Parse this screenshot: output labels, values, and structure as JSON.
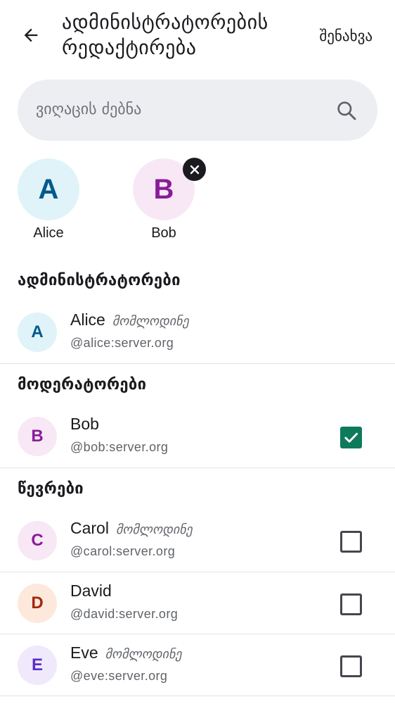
{
  "header": {
    "title": "ადმინისტრატორების რედაქტირება",
    "save_label": "შენახვა",
    "back_icon": "arrow-back-icon"
  },
  "search": {
    "placeholder": "ვიღაცის ძებნა",
    "icon": "search-icon"
  },
  "selected": [
    {
      "initial": "A",
      "name": "Alice",
      "removable": false,
      "avatar_bg": "#dff3f8",
      "avatar_fg": "#005a8c"
    },
    {
      "initial": "B",
      "name": "Bob",
      "removable": true,
      "avatar_bg": "#f8e8f6",
      "avatar_fg": "#8a1c99"
    }
  ],
  "sections": {
    "admins": "ადმინისტრატორები",
    "moderators": "მოდერატორები",
    "members": "წევრები"
  },
  "pending_label": "მომლოდინე",
  "users": {
    "alice": {
      "initial": "A",
      "name": "Alice",
      "handle": "@alice:server.org",
      "pending": "მომლოდინე",
      "avatar_bg": "#dff3f8",
      "avatar_fg": "#005a8c"
    },
    "bob": {
      "initial": "B",
      "name": "Bob",
      "handle": "@bob:server.org",
      "checked": true,
      "avatar_bg": "#f8e8f6",
      "avatar_fg": "#8a1c99"
    },
    "carol": {
      "initial": "C",
      "name": "Carol",
      "handle": "@carol:server.org",
      "pending": "მომლოდინე",
      "checked": false,
      "avatar_bg": "#f8e8f6",
      "avatar_fg": "#8a1c99"
    },
    "david": {
      "initial": "D",
      "name": "David",
      "handle": "@david:server.org",
      "checked": false,
      "avatar_bg": "#fde9dc",
      "avatar_fg": "#a3280c"
    },
    "eve": {
      "initial": "E",
      "name": "Eve",
      "handle": "@eve:server.org",
      "pending": "მომლოდინე",
      "checked": false,
      "avatar_bg": "#efe9fb",
      "avatar_fg": "#5b2ec4"
    }
  },
  "colors": {
    "accent": "#0e7a5c",
    "search_bg": "#eceef2",
    "divider": "#e3e5e8"
  }
}
